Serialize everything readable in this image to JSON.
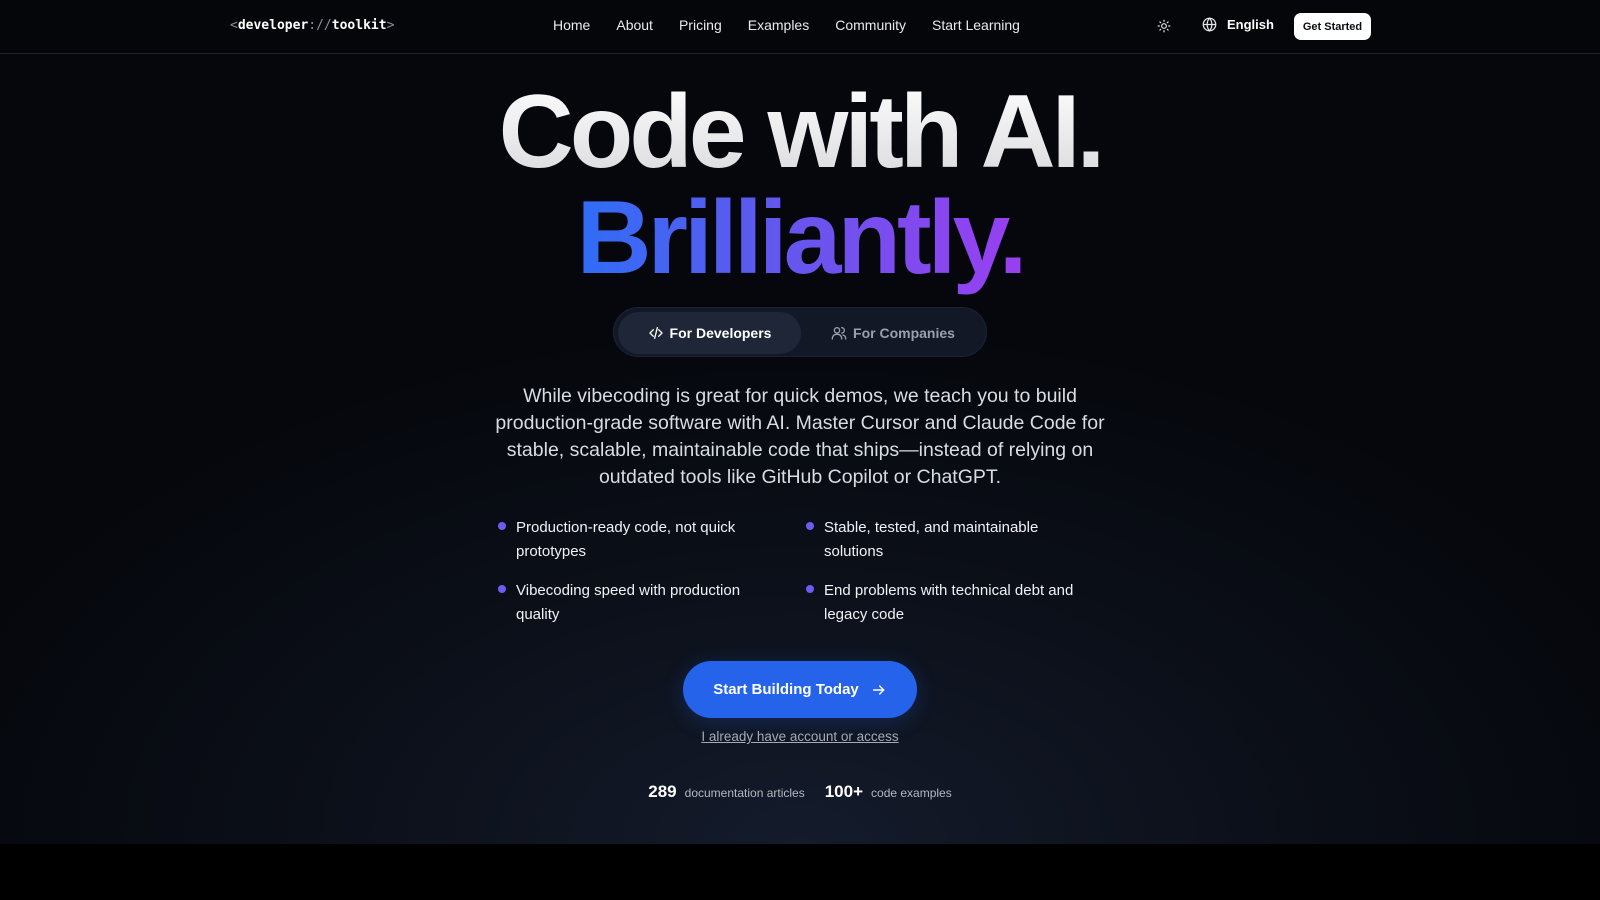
{
  "header": {
    "logo": {
      "open": "<",
      "part1": "developer",
      "sep": "://",
      "part2": "toolkit",
      "close": ">"
    },
    "nav": [
      {
        "label": "Home"
      },
      {
        "label": "About"
      },
      {
        "label": "Pricing"
      },
      {
        "label": "Examples"
      },
      {
        "label": "Community"
      },
      {
        "label": "Start Learning"
      }
    ],
    "theme_icon": "sun-icon",
    "language": {
      "icon": "globe-icon",
      "label": "English"
    },
    "cta_label": "Get Started"
  },
  "hero": {
    "title_line1": "Code with AI.",
    "title_line2": "Brilliantly.",
    "title_gradient": [
      "#2f6df6",
      "#6257ee",
      "#9a3ff0"
    ],
    "tabs": [
      {
        "label": "For Developers",
        "icon": "code-icon",
        "active": true
      },
      {
        "label": "For Companies",
        "icon": "users-icon",
        "active": false
      }
    ],
    "lead": "While vibecoding is great for quick demos, we teach you to build production-grade software with AI. Master Cursor and Claude Code for stable, scalable, maintainable code that ships—instead of relying on outdated tools like GitHub Copilot or ChatGPT.",
    "features": [
      "Production-ready code, not quick prototypes",
      "Stable, tested, and maintainable solutions",
      "Vibecoding speed with production quality",
      "End problems with technical debt and legacy code"
    ],
    "primary_cta": "Start Building Today",
    "primary_cta_icon": "arrow-right-icon",
    "secondary_link": "I already have account or access",
    "stats": [
      {
        "value": "289",
        "label": "documentation articles"
      },
      {
        "value": "100+",
        "label": "code examples"
      }
    ]
  },
  "colors": {
    "accent": "#2563eb",
    "bullet": "#6d5cf1",
    "background": "#0b0f18"
  }
}
